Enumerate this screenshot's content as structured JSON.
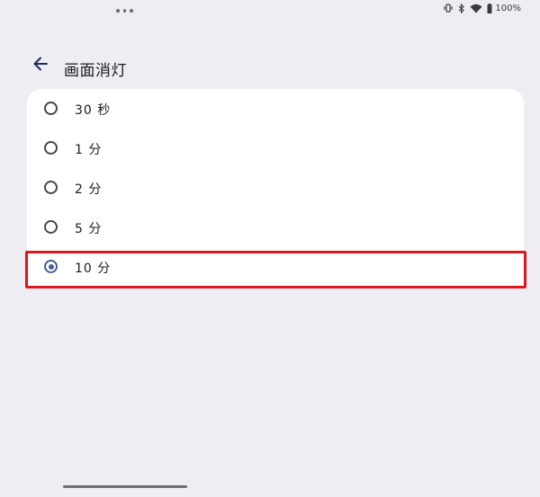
{
  "status_bar": {
    "battery_text": "100%",
    "icons": [
      "vibrate-icon",
      "bluetooth-icon",
      "wifi-icon",
      "battery-icon"
    ]
  },
  "header": {
    "back_icon": "arrow-left-icon",
    "title": "画面消灯"
  },
  "options": [
    {
      "label": "30 秒",
      "selected": false
    },
    {
      "label": "1 分",
      "selected": false
    },
    {
      "label": "2 分",
      "selected": false
    },
    {
      "label": "5 分",
      "selected": false
    },
    {
      "label": "10 分",
      "selected": true
    }
  ],
  "colors": {
    "background": "#eeedf3",
    "card": "#ffffff",
    "accent": "#4a5b92",
    "highlight": "#e0161e",
    "text": "#1b1b21"
  }
}
